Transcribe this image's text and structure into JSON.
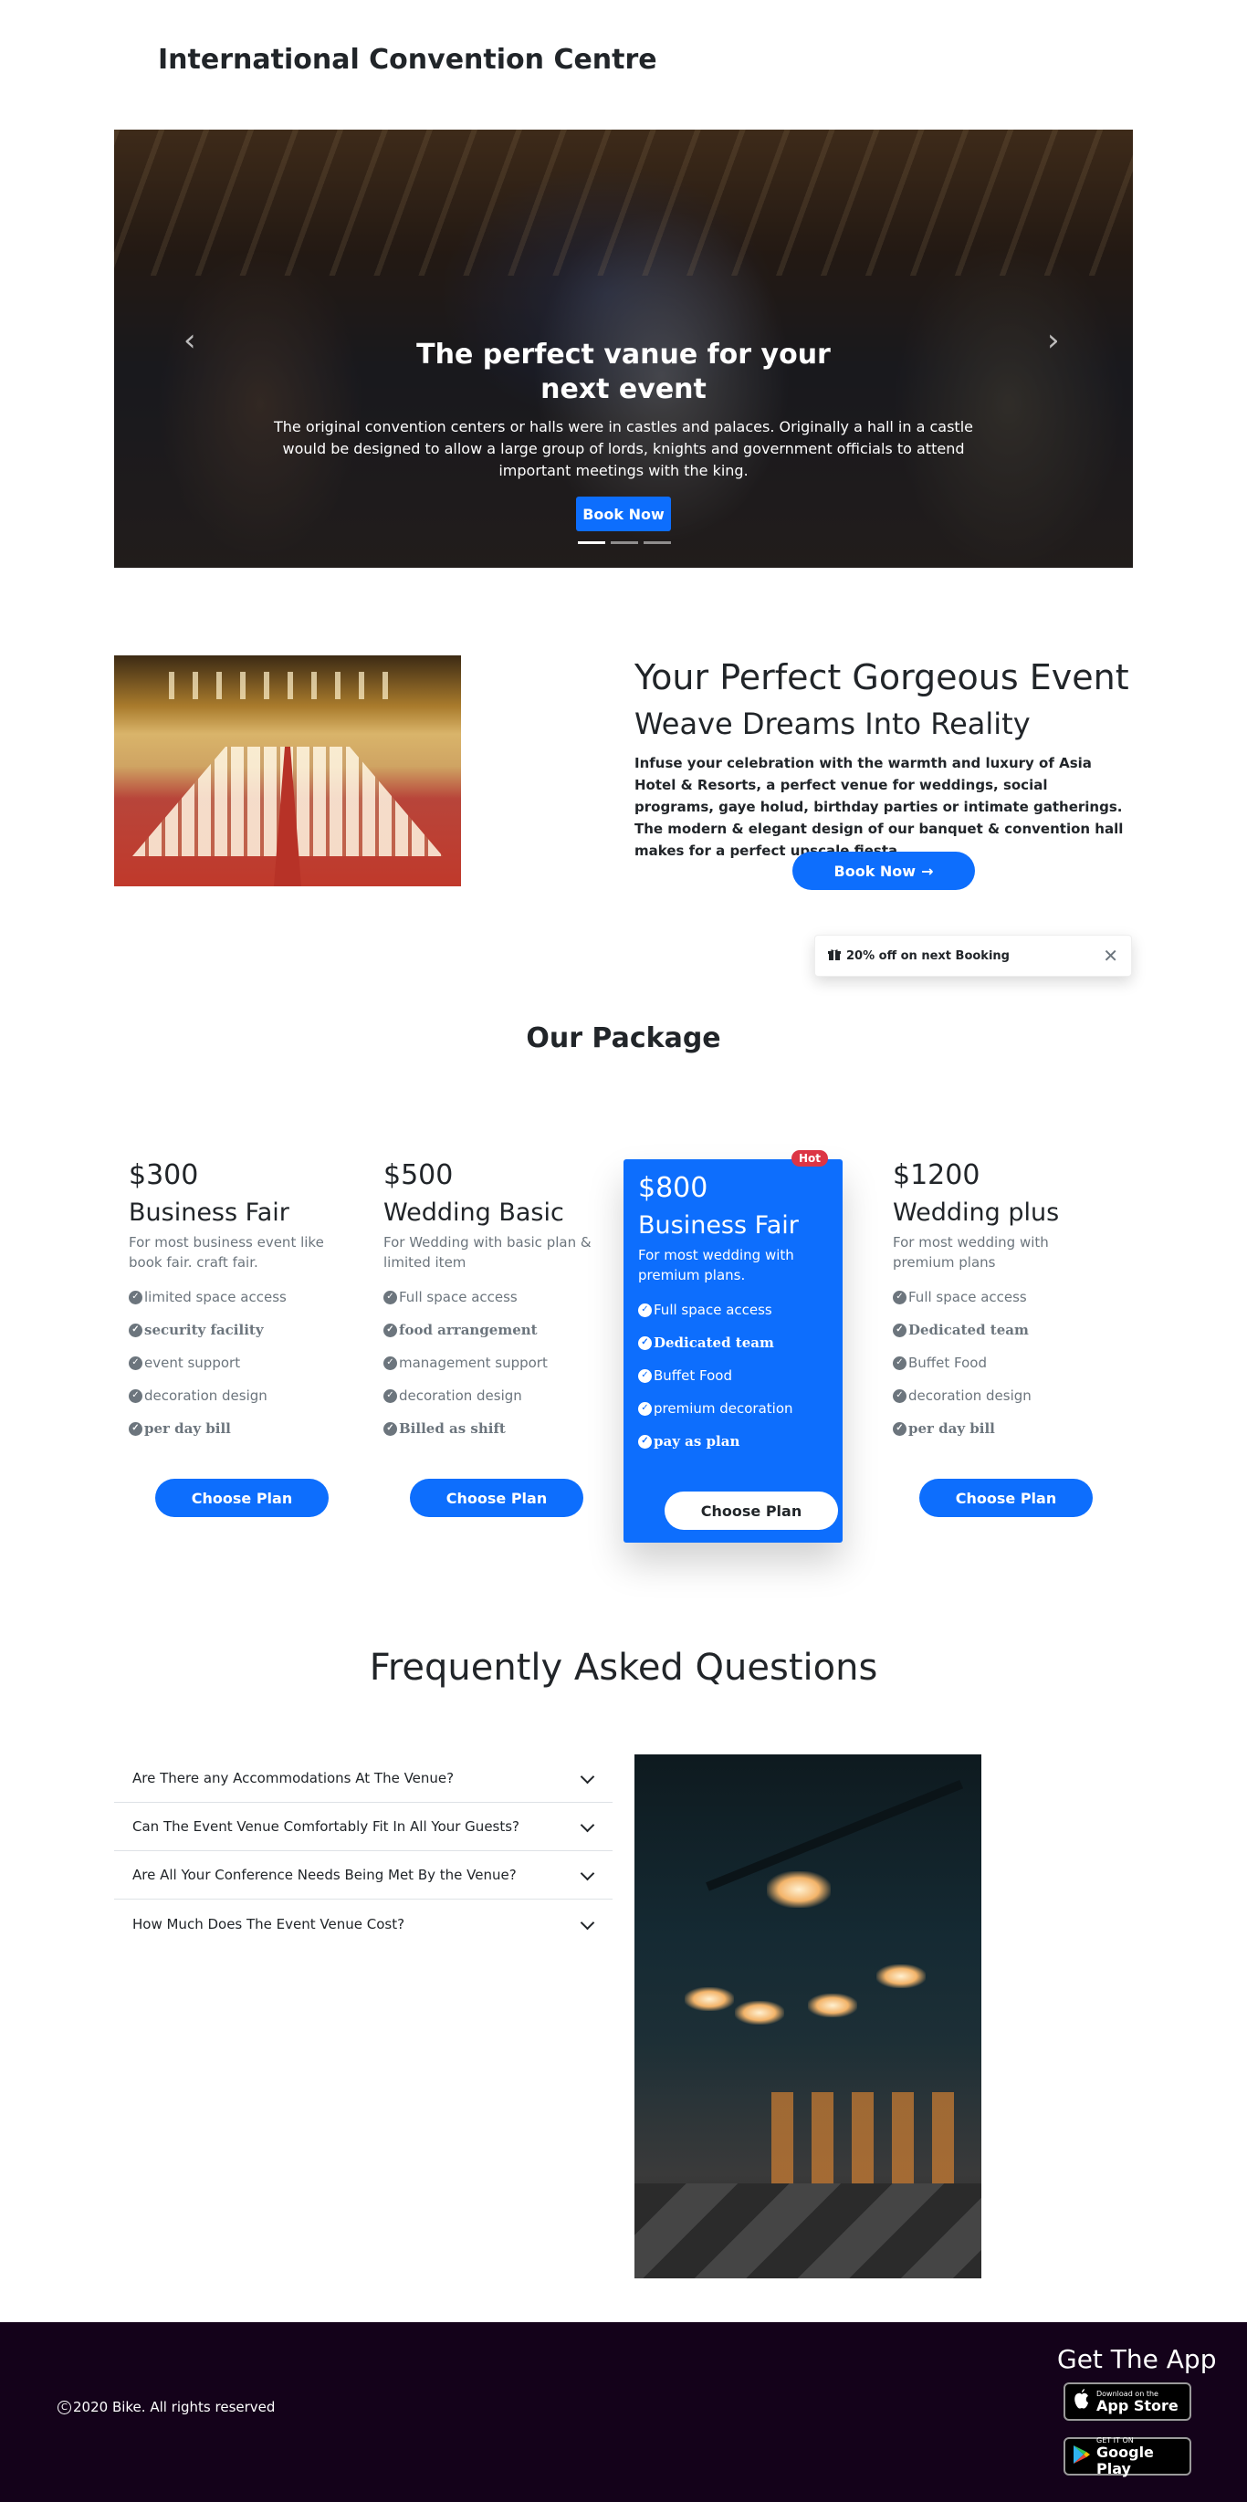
{
  "header": {
    "brand": "International Convention Centre"
  },
  "hero": {
    "title": "The perfect vanue for your next event",
    "text": "The original convention centers or halls were in castles and palaces. Originally a hall in a castle would be designed to allow a large group of lords, knights and government officials to attend important meetings with the king.",
    "button": "Book Now",
    "prev_icon": "chevron-left-icon",
    "next_icon": "chevron-right-icon",
    "slides": 3,
    "active_slide": 1
  },
  "feature": {
    "title": "Your Perfect Gorgeous Event",
    "subtitle": "Weave Dreams Into Reality",
    "text": "Infuse your celebration with the warmth and luxury of Asia Hotel & Resorts, a perfect venue for weddings, social programs, gaye holud, birthday parties or intimate gatherings. The modern & elegant design of our banquet & convention hall makes for a perfect upscale fiesta.",
    "button": "Book Now",
    "button_icon": "arrow-right-icon"
  },
  "toast": {
    "text": "20% off on next Booking",
    "icon": "gift-icon",
    "close_icon": "close-icon"
  },
  "packages": {
    "title": "Our Package",
    "button": "Choose Plan",
    "plans": [
      {
        "price": "$300",
        "name": "Business Fair",
        "desc": "For most business event like book fair. craft fair.",
        "features": [
          "limited space access",
          "security facility",
          "event support",
          "decoration design",
          "per day bill"
        ]
      },
      {
        "price": "$500",
        "name": "Wedding Basic",
        "desc": "For Wedding with basic plan & limited item",
        "features": [
          "Full space access",
          "food arrangement",
          "management support",
          "decoration design",
          "Billed as shift"
        ]
      },
      {
        "price": "$800",
        "name": "Business Fair",
        "desc": "For most wedding with premium plans.",
        "badge": "Hot",
        "features": [
          "Full space access",
          "Dedicated team",
          "Buffet Food",
          "premium decoration",
          "pay as plan"
        ]
      },
      {
        "price": "$1200",
        "name": "Wedding plus",
        "desc": "For most wedding with premium plans",
        "features": [
          "Full space access",
          "Dedicated team",
          "Buffet Food",
          "decoration design",
          "per day bill"
        ]
      }
    ]
  },
  "faq": {
    "title": "Frequently Asked Questions",
    "items": [
      "Are There any Accommodations At The Venue?",
      "Can The Event Venue Comfortably Fit In All Your Guests?",
      "Are All Your Conference Needs Being Met By the Venue?",
      "How Much Does The Event Venue Cost?"
    ]
  },
  "footer": {
    "copyright": "2020 Bike. All rights reserved",
    "copyright_symbol": "C",
    "app_title": "Get The App",
    "app_store": {
      "small": "Download on the",
      "big": "App Store",
      "icon": "apple-icon"
    },
    "google_play": {
      "small": "GET IT ON",
      "big": "Google Play",
      "icon": "play-icon"
    },
    "background": "#14021a"
  },
  "colors": {
    "primary": "#0d6efd",
    "danger": "#dc3545",
    "muted": "#6c757d"
  }
}
